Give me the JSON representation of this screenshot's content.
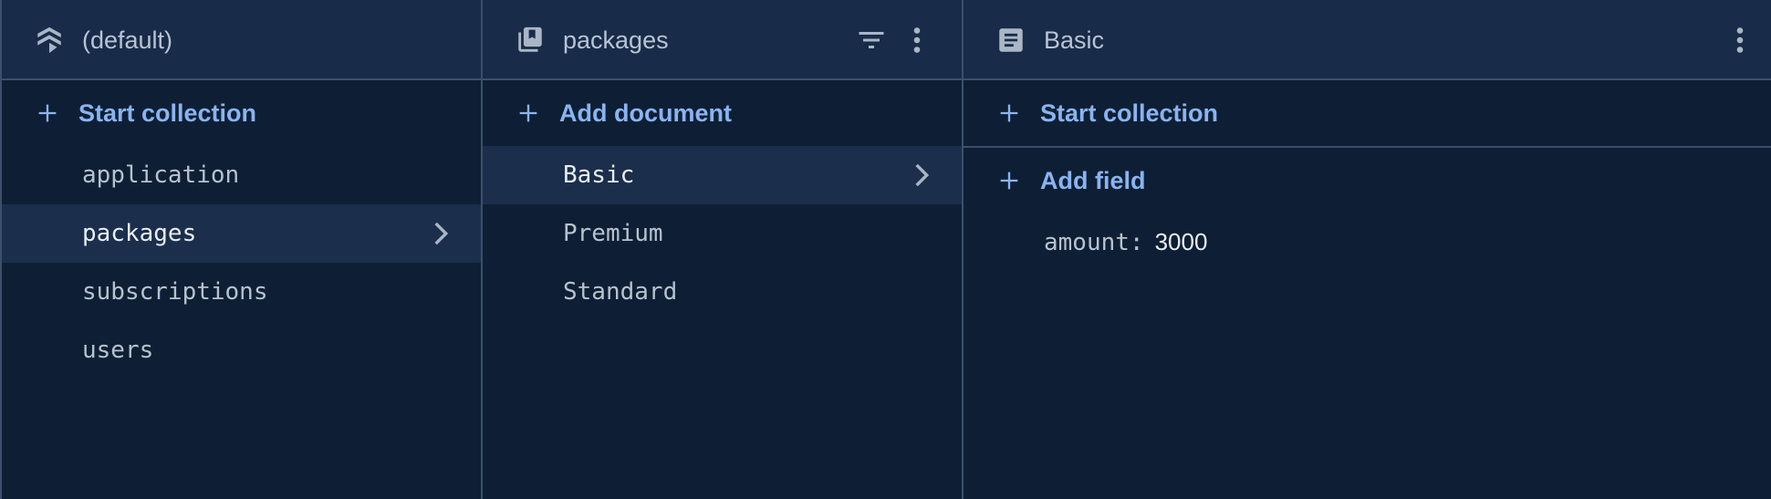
{
  "panes": {
    "root": {
      "title": "(default)",
      "icon": "firestore-stack-icon",
      "action_label": "Start collection",
      "collections": [
        {
          "label": "application",
          "selected": false
        },
        {
          "label": "packages",
          "selected": true
        },
        {
          "label": "subscriptions",
          "selected": false
        },
        {
          "label": "users",
          "selected": false
        }
      ]
    },
    "collection": {
      "title": "packages",
      "icon": "collection-icon",
      "action_label": "Add document",
      "documents": [
        {
          "label": "Basic",
          "selected": true
        },
        {
          "label": "Premium",
          "selected": false
        },
        {
          "label": "Standard",
          "selected": false
        }
      ]
    },
    "document": {
      "title": "Basic",
      "icon": "document-icon",
      "start_collection_label": "Start collection",
      "add_field_label": "Add field",
      "fields": [
        {
          "key": "amount:",
          "value": "3000"
        }
      ]
    }
  },
  "colors": {
    "background": "#0e1f35",
    "header": "#182b48",
    "accent": "#8ab4f0",
    "selected_row": "#1b2e4b",
    "divider": "#3c506c"
  }
}
